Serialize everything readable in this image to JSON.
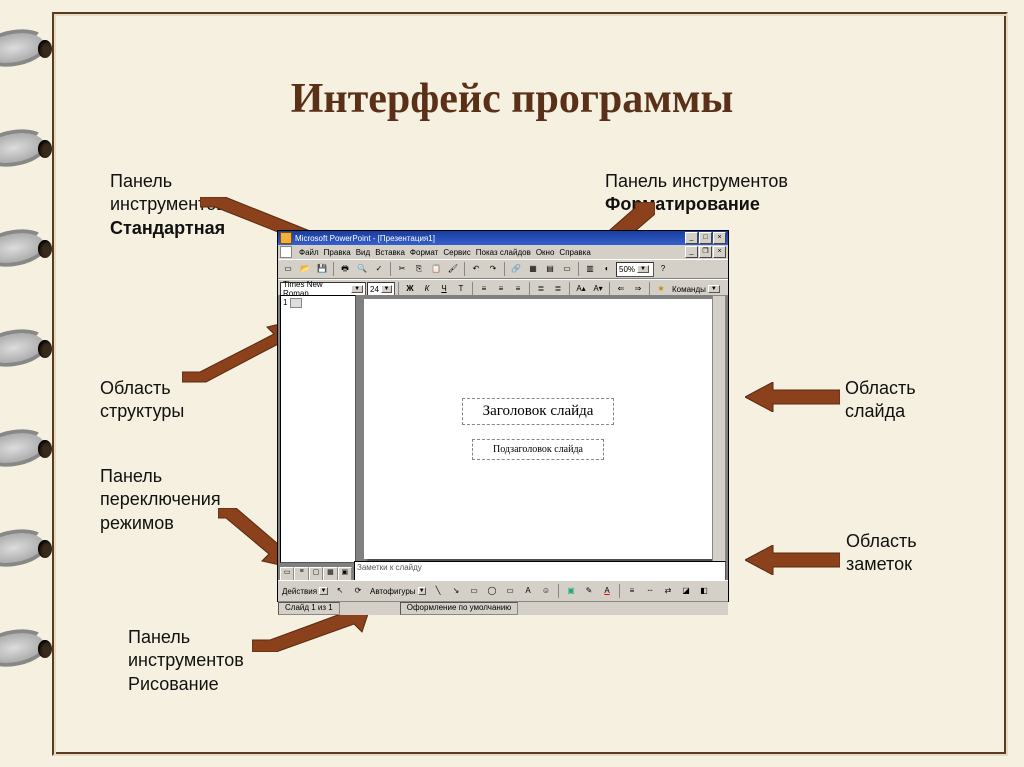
{
  "slide": {
    "title": "Интерфейс программы"
  },
  "labels": {
    "std_toolbar": {
      "line1": "Панель",
      "line2": "инструментов",
      "line3": "Стандартная"
    },
    "fmt_toolbar": {
      "line1": "Панель инструментов",
      "line2": "Форматирование"
    },
    "outline": {
      "line1": "Область",
      "line2": "структуры"
    },
    "slide_area": {
      "line1": "Область",
      "line2": "слайда"
    },
    "view_switch": {
      "line1": "Панель",
      "line2": "переключения",
      "line3": "режимов"
    },
    "notes_area": {
      "line1": "Область",
      "line2": "заметок"
    },
    "draw_toolbar": {
      "line1": "Панель",
      "line2": "инструментов",
      "line3": "Рисование"
    }
  },
  "app": {
    "title": "Microsoft PowerPoint - [Презентация1]",
    "menus": [
      "Файл",
      "Правка",
      "Вид",
      "Вставка",
      "Формат",
      "Сервис",
      "Показ слайдов",
      "Окно",
      "Справка"
    ],
    "font_name": "Times New Roman",
    "font_size": "24",
    "zoom": "50%",
    "commands_btn": "Команды",
    "slide_title_ph": "Заголовок слайда",
    "slide_sub_ph": "Подзаголовок слайда",
    "notes_ph": "Заметки к слайду",
    "outline_marker": "1",
    "draw_actions": "Действия",
    "autoshapes": "Автофигуры",
    "status_slide": "Слайд 1 из 1",
    "status_template": "Оформление по умолчанию"
  }
}
